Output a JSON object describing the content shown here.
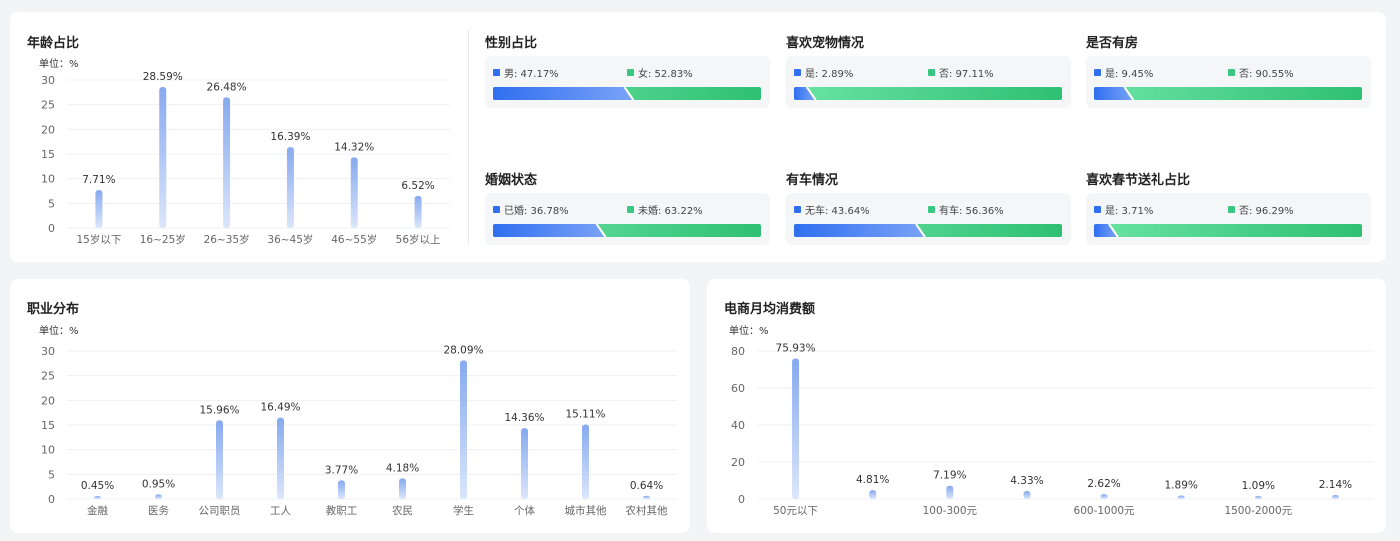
{
  "age": {
    "title": "年龄占比",
    "chart_data": {
      "type": "bar",
      "unit_label": "单位：%",
      "categories": [
        "15岁以下",
        "16~25岁",
        "26~35岁",
        "36~45岁",
        "46~55岁",
        "56岁以上"
      ],
      "values": [
        7.71,
        28.59,
        26.48,
        16.39,
        14.32,
        6.52
      ],
      "labels": [
        "7.71%",
        "28.59%",
        "26.48%",
        "16.39%",
        "14.32%",
        "6.52%"
      ],
      "yticks": [
        0,
        5,
        10,
        15,
        20,
        25,
        30
      ],
      "ylim": [
        0,
        30
      ]
    }
  },
  "ratios": [
    {
      "title": "性别占比",
      "a_label": "男: 47.17%",
      "b_label": "女: 52.83%",
      "a_value": 47.17
    },
    {
      "title": "喜欢宠物情况",
      "a_label": "是: 2.89%",
      "b_label": "否: 97.11%",
      "a_value": 2.89
    },
    {
      "title": "是否有房",
      "a_label": "是: 9.45%",
      "b_label": "否: 90.55%",
      "a_value": 9.45
    },
    {
      "title": "婚姻状态",
      "a_label": "已婚: 36.78%",
      "b_label": "未婚: 63.22%",
      "a_value": 36.78
    },
    {
      "title": "有车情况",
      "a_label": "无车: 43.64%",
      "b_label": "有车: 56.36%",
      "a_value": 43.64
    },
    {
      "title": "喜欢春节送礼占比",
      "a_label": "是: 3.71%",
      "b_label": "否: 96.29%",
      "a_value": 3.71
    }
  ],
  "occupation": {
    "title": "职业分布",
    "chart_data": {
      "type": "bar",
      "unit_label": "单位：%",
      "categories": [
        "金融",
        "医务",
        "公司职员",
        "工人",
        "教职工",
        "农民",
        "学生",
        "个体",
        "城市其他",
        "农村其他"
      ],
      "values": [
        0.45,
        0.95,
        15.96,
        16.49,
        3.77,
        4.18,
        28.09,
        14.36,
        15.11,
        0.64
      ],
      "labels": [
        "0.45%",
        "0.95%",
        "15.96%",
        "16.49%",
        "3.77%",
        "4.18%",
        "28.09%",
        "14.36%",
        "15.11%",
        "0.64%"
      ],
      "yticks": [
        0,
        5,
        10,
        15,
        20,
        25,
        30
      ],
      "ylim": [
        0,
        30
      ]
    }
  },
  "ecommerce": {
    "title": "电商月均消费额",
    "chart_data": {
      "type": "bar",
      "unit_label": "单位：%",
      "categories": [
        "50元以下",
        "",
        "100-300元",
        "",
        "600-1000元",
        "",
        "1500-2000元",
        ""
      ],
      "values": [
        75.93,
        4.81,
        7.19,
        4.33,
        2.62,
        1.89,
        1.09,
        2.14
      ],
      "labels": [
        "75.93%",
        "4.81%",
        "7.19%",
        "4.33%",
        "2.62%",
        "1.89%",
        "1.09%",
        "2.14%"
      ],
      "yticks": [
        0,
        20,
        40,
        60,
        80
      ],
      "ylim": [
        0,
        80
      ]
    }
  },
  "colors": {
    "bar_top": "#86a9ef",
    "bar_bottom": "#dbe6fb",
    "blue": "#2f6ff0",
    "blue_light": "#7aa2f7",
    "green": "#2fc073",
    "green_light": "#6ae3a3"
  }
}
